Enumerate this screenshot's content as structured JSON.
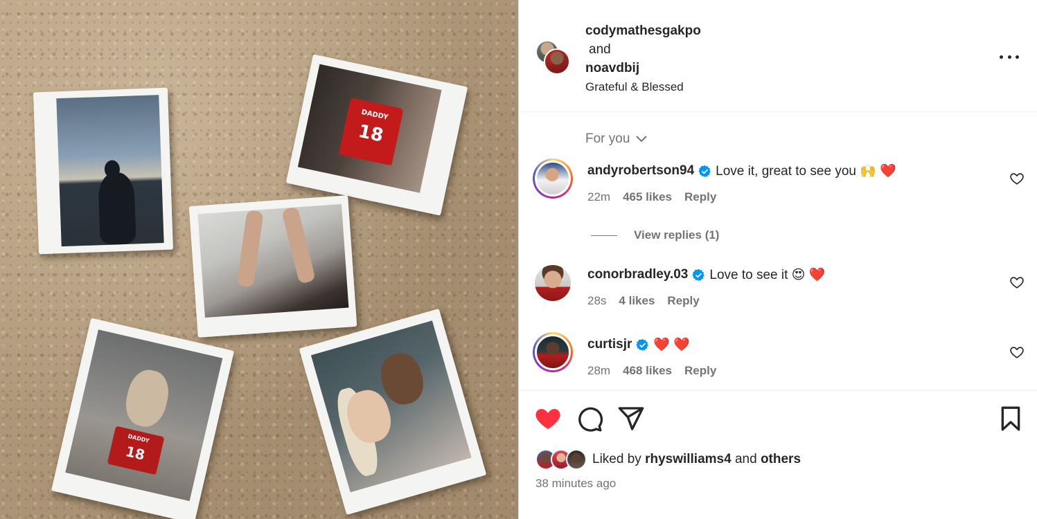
{
  "post": {
    "author_primary": "codymathesgakpo",
    "author_joiner": "and",
    "author_secondary": "noavdbij",
    "caption": "Grateful & Blessed"
  },
  "photo": {
    "jersey_top_text": "DADDY",
    "jersey_number": "18",
    "shirt_top_text": "DADDY",
    "shirt_number": "18"
  },
  "comments_filter": "For you",
  "comments": [
    {
      "username": "andyrobertson94",
      "verified": true,
      "text": "Love it, great to see you 🙌 ❤️",
      "time": "22m",
      "likes": "465 likes",
      "reply": "Reply",
      "story_ring": true
    },
    {
      "username": "conorbradley.03",
      "verified": true,
      "text": "Love to see it 😍 ❤️",
      "time": "28s",
      "likes": "4 likes",
      "reply": "Reply",
      "story_ring": false
    },
    {
      "username": "curtisjr",
      "verified": true,
      "text": "❤️ ❤️",
      "time": "28m",
      "likes": "468 likes",
      "reply": "Reply",
      "story_ring": true
    }
  ],
  "view_replies": "View replies (1)",
  "actions": {
    "like_icon": "heart-filled-icon",
    "comment_icon": "comment-icon",
    "share_icon": "paper-plane-icon",
    "save_icon": "bookmark-icon",
    "like_color": "#ff3040"
  },
  "liked_by": {
    "prefix": "Liked by",
    "user": "rhyswilliams4",
    "joiner": "and",
    "others": "others"
  },
  "time_ago": "38 minutes ago",
  "colors": {
    "verified": "#0095f6",
    "secondary_text": "#737373",
    "primary_text": "#262626"
  }
}
